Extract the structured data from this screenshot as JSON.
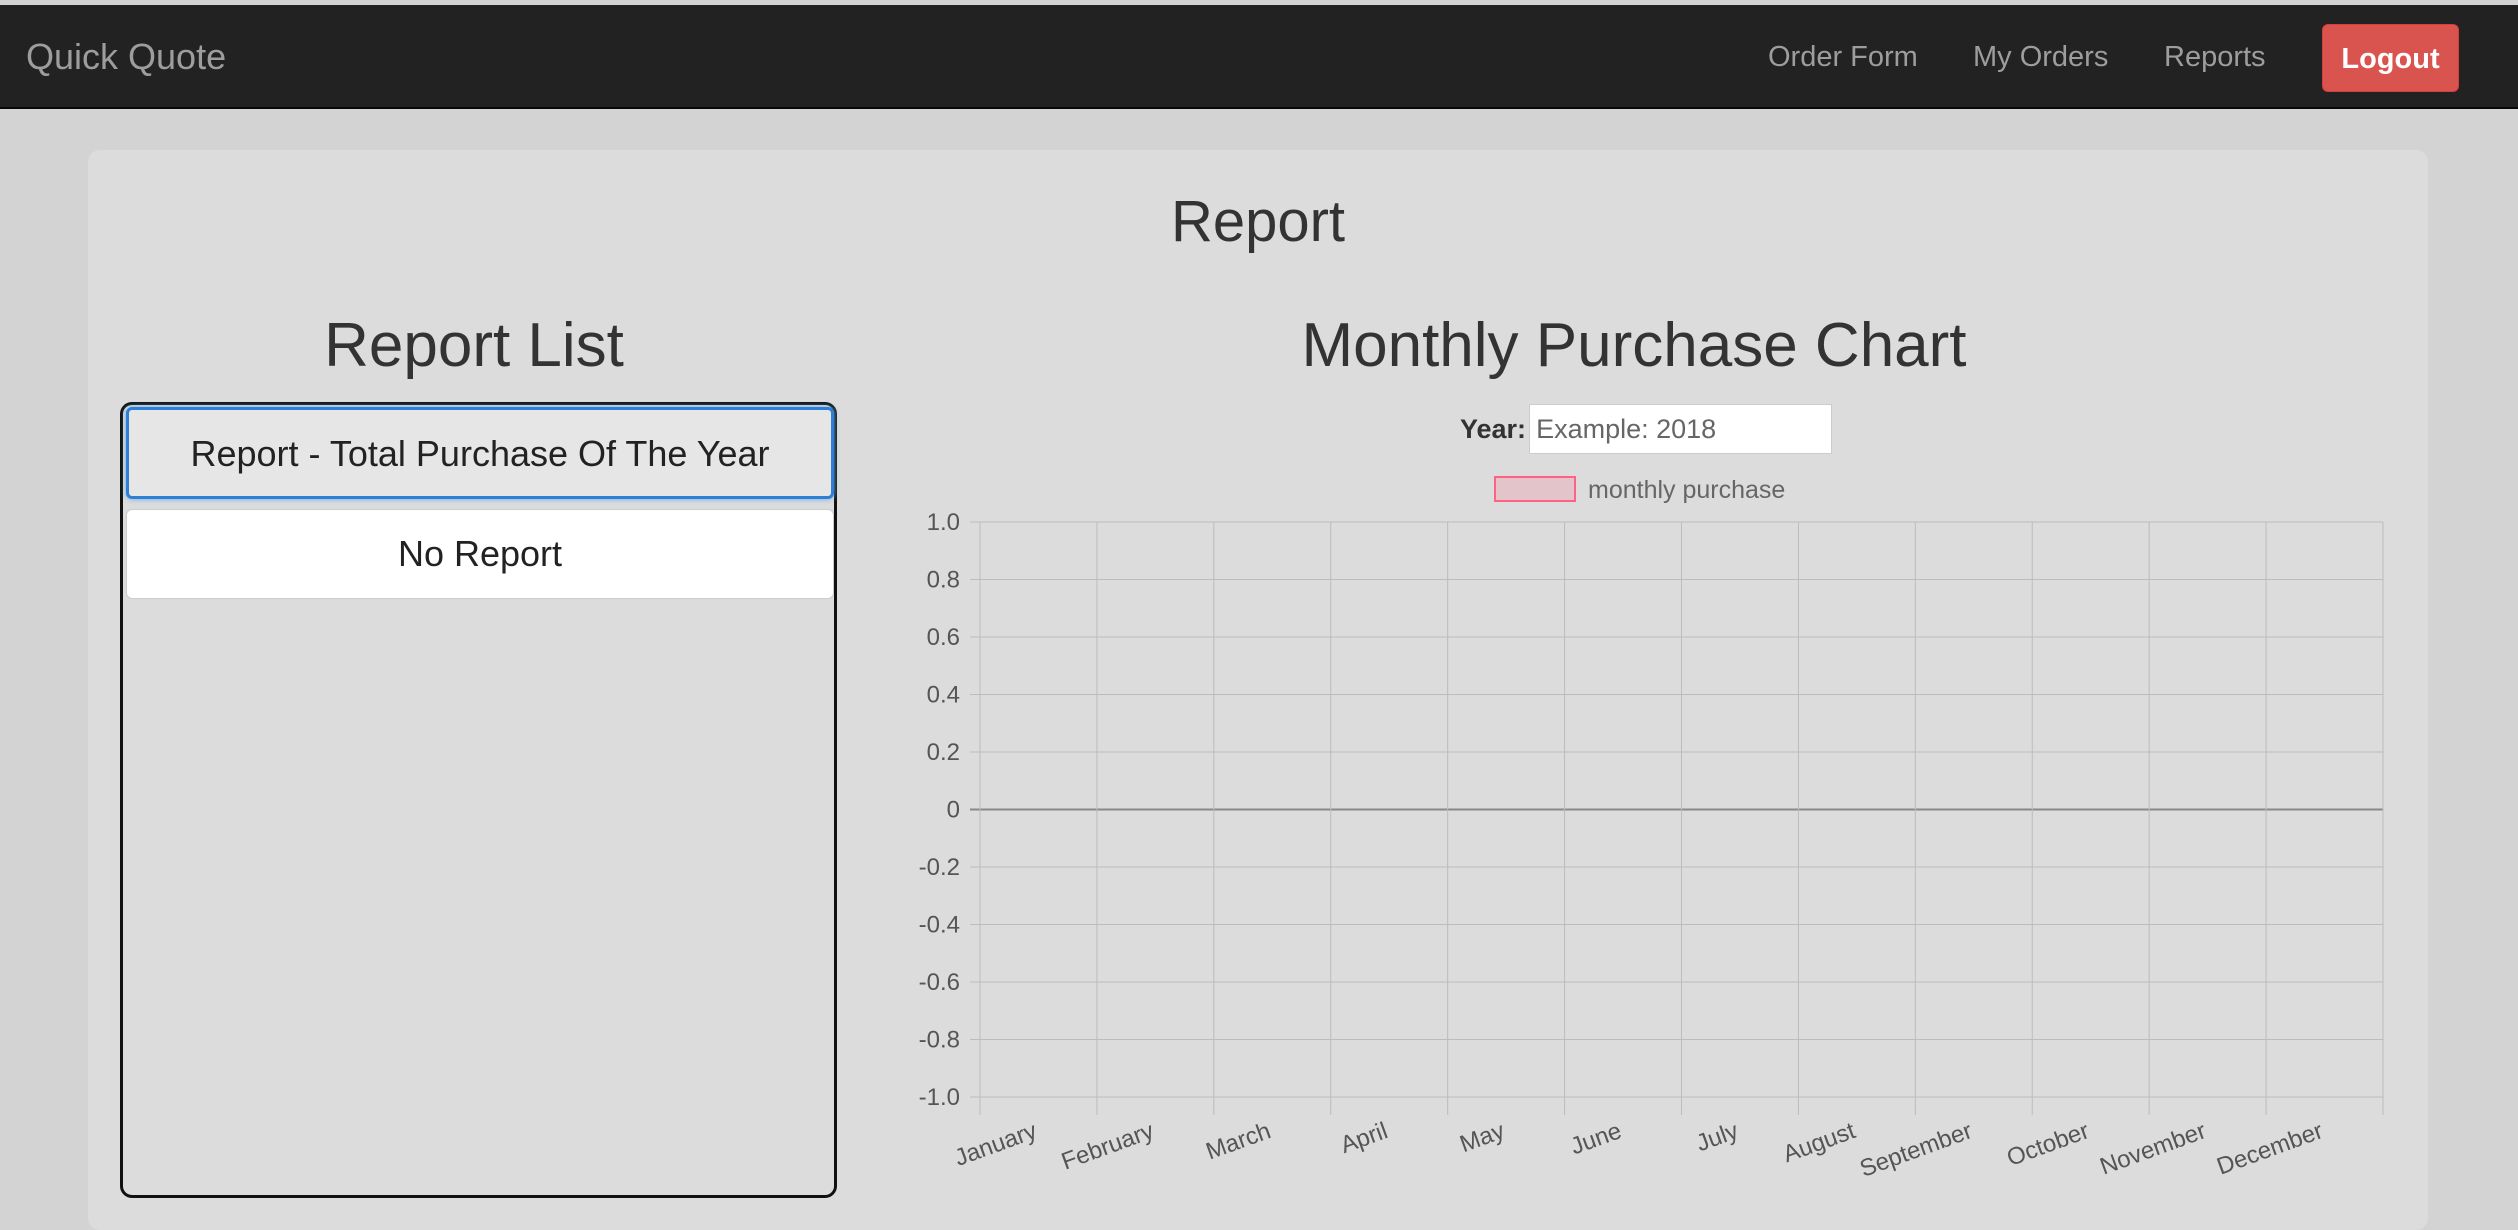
{
  "navbar": {
    "brand": "Quick Quote",
    "links": [
      "Order Form",
      "My Orders",
      "Reports"
    ],
    "logout_label": "Logout"
  },
  "page": {
    "title": "Report"
  },
  "report_list": {
    "heading": "Report List",
    "items": [
      "Report - Total Purchase Of The Year",
      "No Report"
    ]
  },
  "chart_section": {
    "heading": "Monthly Purchase Chart",
    "year_label": "Year:",
    "year_placeholder": "Example: 2018"
  },
  "colors": {
    "navbar_bg": "#222222",
    "logout_bg": "#d9534f",
    "series_fill": "rgba(255,99,132,0.2)",
    "series_border": "#ff6384"
  },
  "chart_data": {
    "type": "bar",
    "categories": [
      "January",
      "February",
      "March",
      "April",
      "May",
      "June",
      "July",
      "August",
      "September",
      "October",
      "November",
      "December"
    ],
    "series": [
      {
        "name": "monthly purchase",
        "values": []
      }
    ],
    "ylim": [
      -1.0,
      1.0
    ],
    "yticks": [
      "1.0",
      "0.8",
      "0.6",
      "0.4",
      "0.2",
      "0",
      "-0.2",
      "-0.4",
      "-0.6",
      "-0.8",
      "-1.0"
    ],
    "grid": true,
    "legend": "top-center",
    "title": "",
    "xlabel": "",
    "ylabel": ""
  }
}
